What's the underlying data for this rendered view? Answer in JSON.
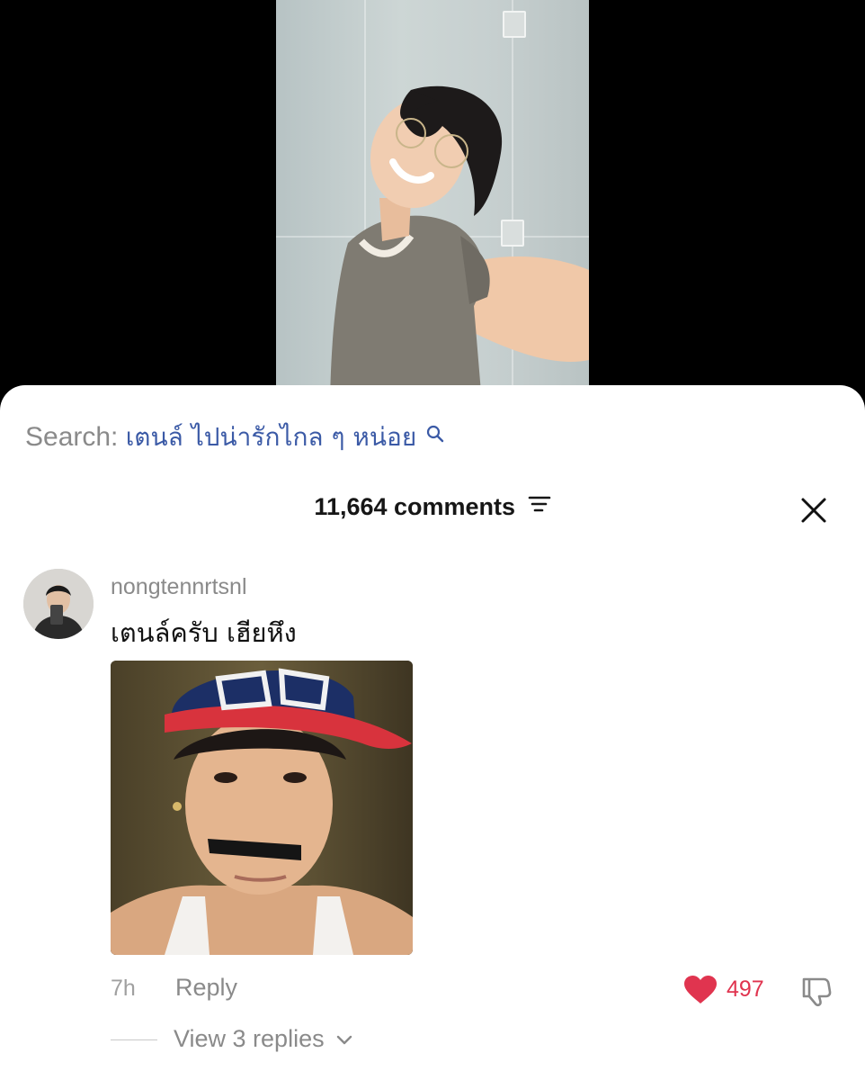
{
  "search": {
    "prefix": "Search:",
    "query": "เตนล์ ไปน่ารักไกล ๆ หน่อย"
  },
  "comments_header": {
    "count_label": "11,664 comments"
  },
  "comment": {
    "username": "nongtennrtsnl",
    "text": "เตนล์ครับ เฮียหึง",
    "time": "7h",
    "reply_label": "Reply",
    "like_count": "497",
    "view_replies_label": "View 3 replies"
  },
  "colors": {
    "like": "#e0344f",
    "search_query": "#3b5aa6",
    "muted": "#8a8a8a"
  },
  "icons": [
    "search-icon",
    "sort-icon",
    "close-icon",
    "heart-icon",
    "dislike-icon",
    "chevron-down-icon"
  ]
}
